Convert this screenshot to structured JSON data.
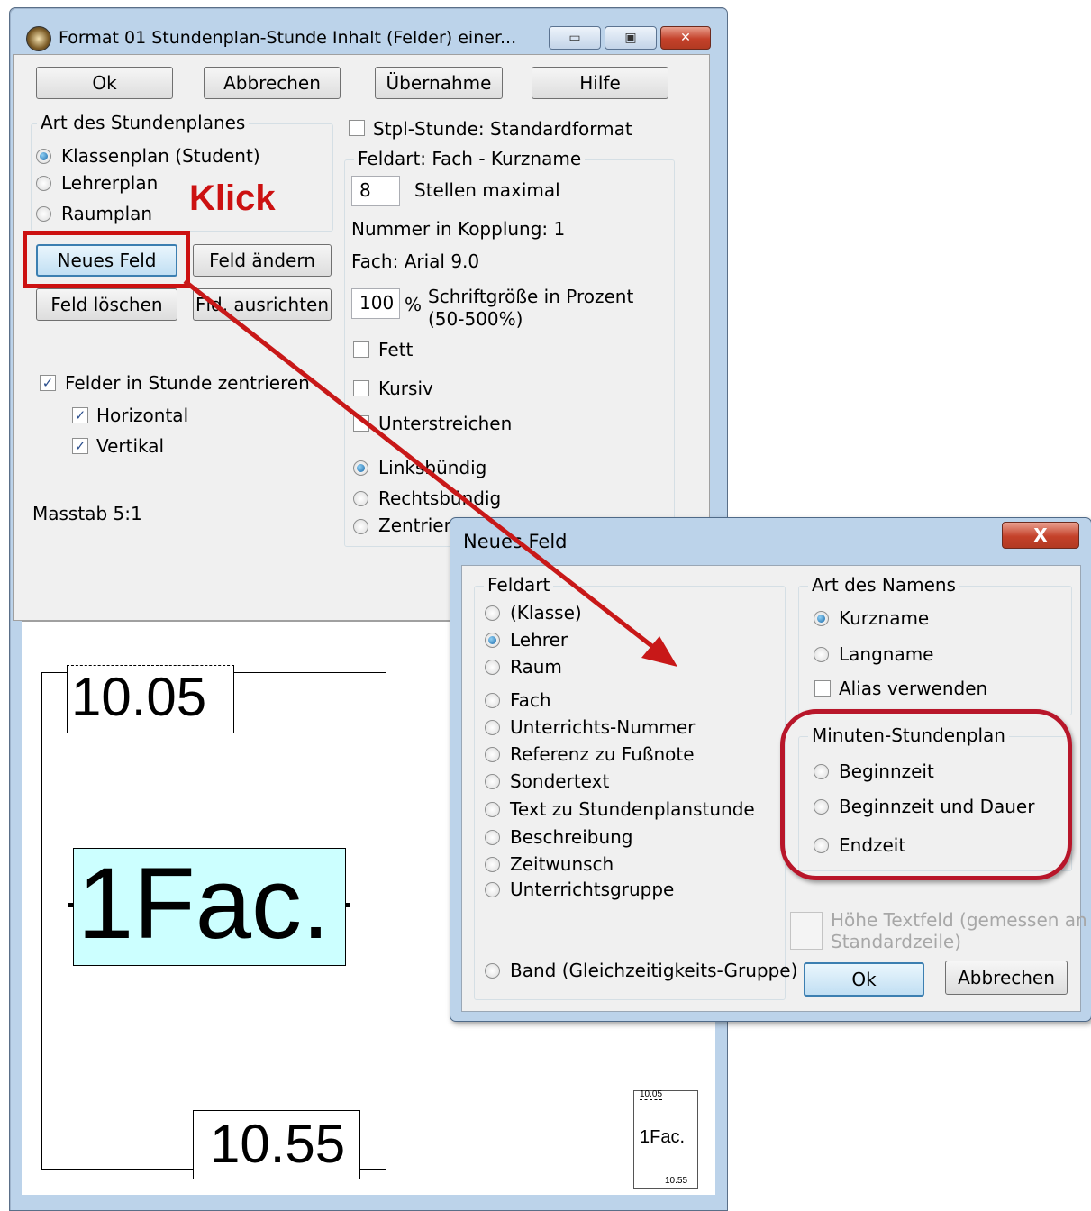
{
  "main_window": {
    "title": "Format 01  Stundenplan-Stunde  Inhalt (Felder) einer...",
    "buttons": {
      "ok": "Ok",
      "cancel": "Abbrechen",
      "apply": "Übernahme",
      "help": "Hilfe"
    },
    "plan_type_group": {
      "caption": "Art des Stundenplanes",
      "options": [
        "Klassenplan (Student)",
        "Lehrerplan",
        "Raumplan"
      ],
      "selected": "Klassenplan (Student)"
    },
    "annotation_klick": "Klick",
    "field_buttons": {
      "new": "Neues Feld",
      "change": "Feld ändern",
      "delete": "Feld löschen",
      "align": "Fld. ausrichten"
    },
    "center_fields": {
      "label": "Felder in Stunde zentrieren",
      "checked": true
    },
    "horizontal": {
      "label": "Horizontal",
      "checked": true
    },
    "vertical": {
      "label": "Vertikal",
      "checked": true
    },
    "scale": "Masstab  5:1",
    "std_format": {
      "label": "Stpl-Stunde: Standardformat",
      "checked": false
    },
    "field_group": {
      "caption": "Feldart: Fach - Kurzname",
      "max_chars_value": "8",
      "max_chars_label": "Stellen maximal",
      "coupling": "Nummer in Kopplung: 1",
      "font": "Fach: Arial 9.0",
      "font_size_value": "100",
      "percent_sign": "%",
      "font_size_label_1": "Schriftgröße in Prozent",
      "font_size_label_2": "(50-500%)",
      "bold": "Fett",
      "italic": "Kursiv",
      "underline": "Unterstreichen",
      "align_left": "Linksbündig",
      "align_right": "Rechtsbündig",
      "align_center": "Zentriert (",
      "selected_align": "Linksbündig"
    },
    "preview": {
      "start_time": "10.05",
      "subject": "1Fac.",
      "end_time": "10.55",
      "thumb_start": "10.05",
      "thumb_subject": "1Fac.",
      "thumb_end": "10.55"
    }
  },
  "dialog": {
    "title": "Neues Feld",
    "close_glyph": "X",
    "field_type": {
      "caption": "Feldart",
      "options": [
        "(Klasse)",
        "Lehrer",
        "Raum",
        "Fach",
        "Unterrichts-Nummer",
        "Referenz zu Fußnote",
        "Sondertext",
        "Text zu Stundenplanstunde",
        "Beschreibung",
        "Zeitwunsch",
        "Unterrichtsgruppe"
      ],
      "band": "Band (Gleichzeitigkeits-Gruppe)",
      "selected": "Lehrer"
    },
    "name_type": {
      "caption": "Art des Namens",
      "short": "Kurzname",
      "long": "Langname",
      "alias": "Alias verwenden",
      "selected": "Kurzname"
    },
    "minutes_plan": {
      "caption": "Minuten-Stundenplan",
      "options": [
        "Beginnzeit",
        "Beginnzeit und Dauer",
        "Endzeit"
      ]
    },
    "height_text_1": "Höhe Textfeld (gemessen an",
    "height_text_2": "Standardzeile)",
    "ok": "Ok",
    "cancel": "Abbrechen"
  },
  "colors": {
    "highlight": "#cc1111",
    "field_fill": "#ccffff",
    "title_bar": "#bcd3ea"
  }
}
